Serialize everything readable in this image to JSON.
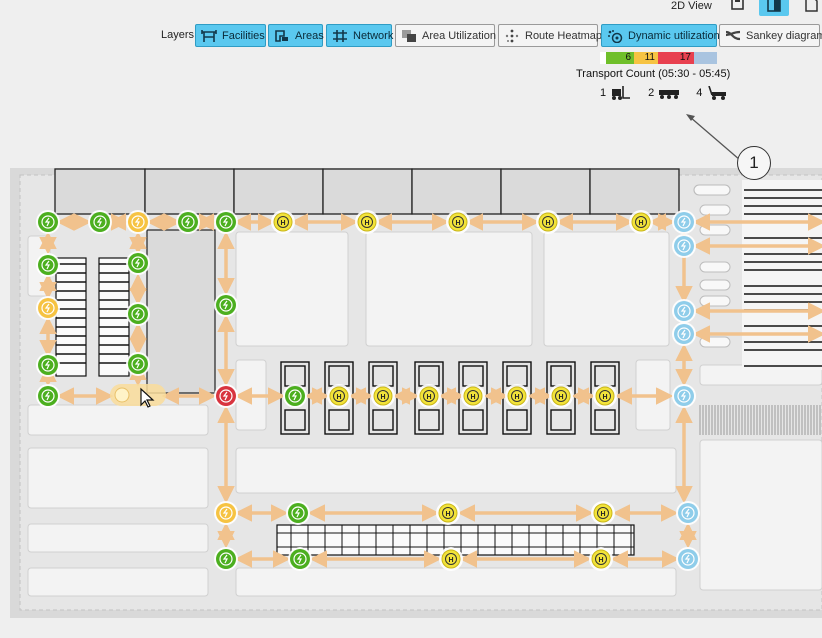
{
  "toolbar": {
    "layers_label": "Layers",
    "view_label": "2D View",
    "buttons": [
      {
        "label": "Facilities",
        "icon": "facilities-icon",
        "active": true
      },
      {
        "label": "Areas",
        "icon": "areas-icon",
        "active": true
      },
      {
        "label": "Network",
        "icon": "network-icon",
        "active": true
      },
      {
        "label": "Area Utilization",
        "icon": "area-utilization-icon",
        "active": false
      },
      {
        "label": "Route Heatmap",
        "icon": "route-heatmap-icon",
        "active": false
      },
      {
        "label": "Dynamic utilization",
        "icon": "dynamic-utilization-icon",
        "active": true
      },
      {
        "label": "Sankey diagram",
        "icon": "sankey-diagram-icon",
        "active": false
      }
    ]
  },
  "legend": {
    "segments": [
      {
        "label": "",
        "color": "#ffffff"
      },
      {
        "label": "6",
        "color": "#6fbf2a"
      },
      {
        "label": "11",
        "color": "#f6c342"
      },
      {
        "label": "17",
        "color": "#e8404f"
      },
      {
        "label": "",
        "color": "#a9c4e0"
      }
    ],
    "title": "Transport Count (05:30 - 05:45)",
    "counts": [
      {
        "value": "1",
        "icon": "forklift-icon"
      },
      {
        "value": "2",
        "icon": "tugger-train-icon"
      },
      {
        "value": "4",
        "icon": "hand-pallet-truck-icon"
      }
    ]
  },
  "callout": {
    "number": "1"
  },
  "node_colors": {
    "green": "#4caf1f",
    "yellow": "#f6c342",
    "red": "#d8343f",
    "blue": "#8fcdea",
    "hub": "#f2e33a"
  },
  "route_color": "#f1c28d",
  "hub_label": "H"
}
